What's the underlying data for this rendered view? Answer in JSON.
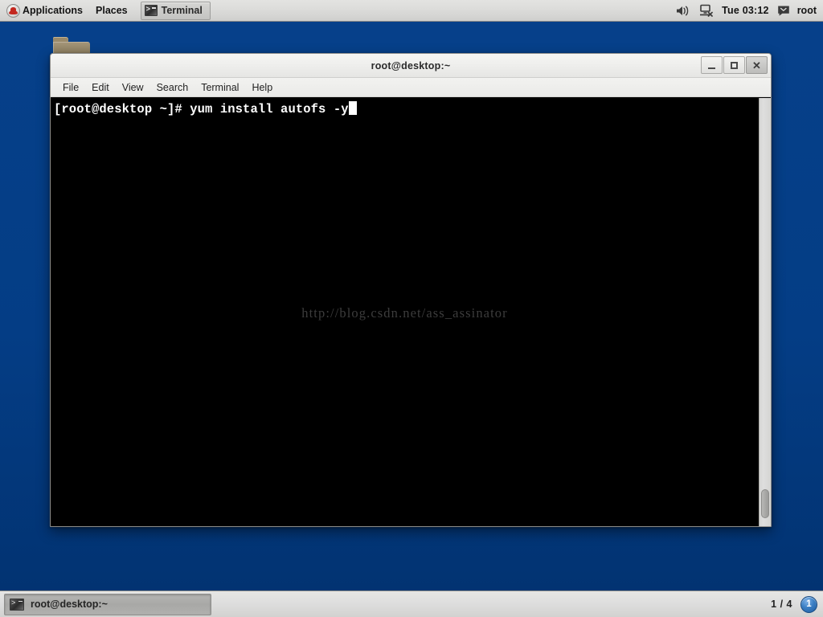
{
  "top_panel": {
    "logo_icon": "redhat-logo-icon",
    "menus": [
      {
        "label": "Applications"
      },
      {
        "label": "Places"
      }
    ],
    "tasks": [
      {
        "label": "Terminal",
        "icon": "terminal-icon"
      }
    ],
    "tray": {
      "volume_icon": "speaker-icon",
      "network_icon": "network-disconnected-icon",
      "clock": "Tue 03:12",
      "messaging_icon": "messaging-icon",
      "user": "root"
    }
  },
  "desktop": {
    "background_color": "#043d85",
    "icons": [
      {
        "name": "folder-icon",
        "label": ""
      }
    ]
  },
  "terminal_window": {
    "title": "root@desktop:~",
    "controls": {
      "minimize": "_",
      "maximize": "□",
      "close": "✕"
    },
    "menubar": [
      {
        "label": "File"
      },
      {
        "label": "Edit"
      },
      {
        "label": "View"
      },
      {
        "label": "Search"
      },
      {
        "label": "Terminal"
      },
      {
        "label": "Help"
      }
    ],
    "screen": {
      "prompt": "[root@desktop ~]# ",
      "command": "yum install autofs -y",
      "cursor": "block",
      "foreground_color": "#ffffff",
      "background_color": "#000000",
      "watermark": "http://blog.csdn.net/ass_assinator"
    }
  },
  "bottom_panel": {
    "tasks": [
      {
        "label": "root@desktop:~",
        "icon": "terminal-icon",
        "active": true
      }
    ],
    "workspace": {
      "count_label": "1 / 4",
      "current": "1"
    }
  }
}
